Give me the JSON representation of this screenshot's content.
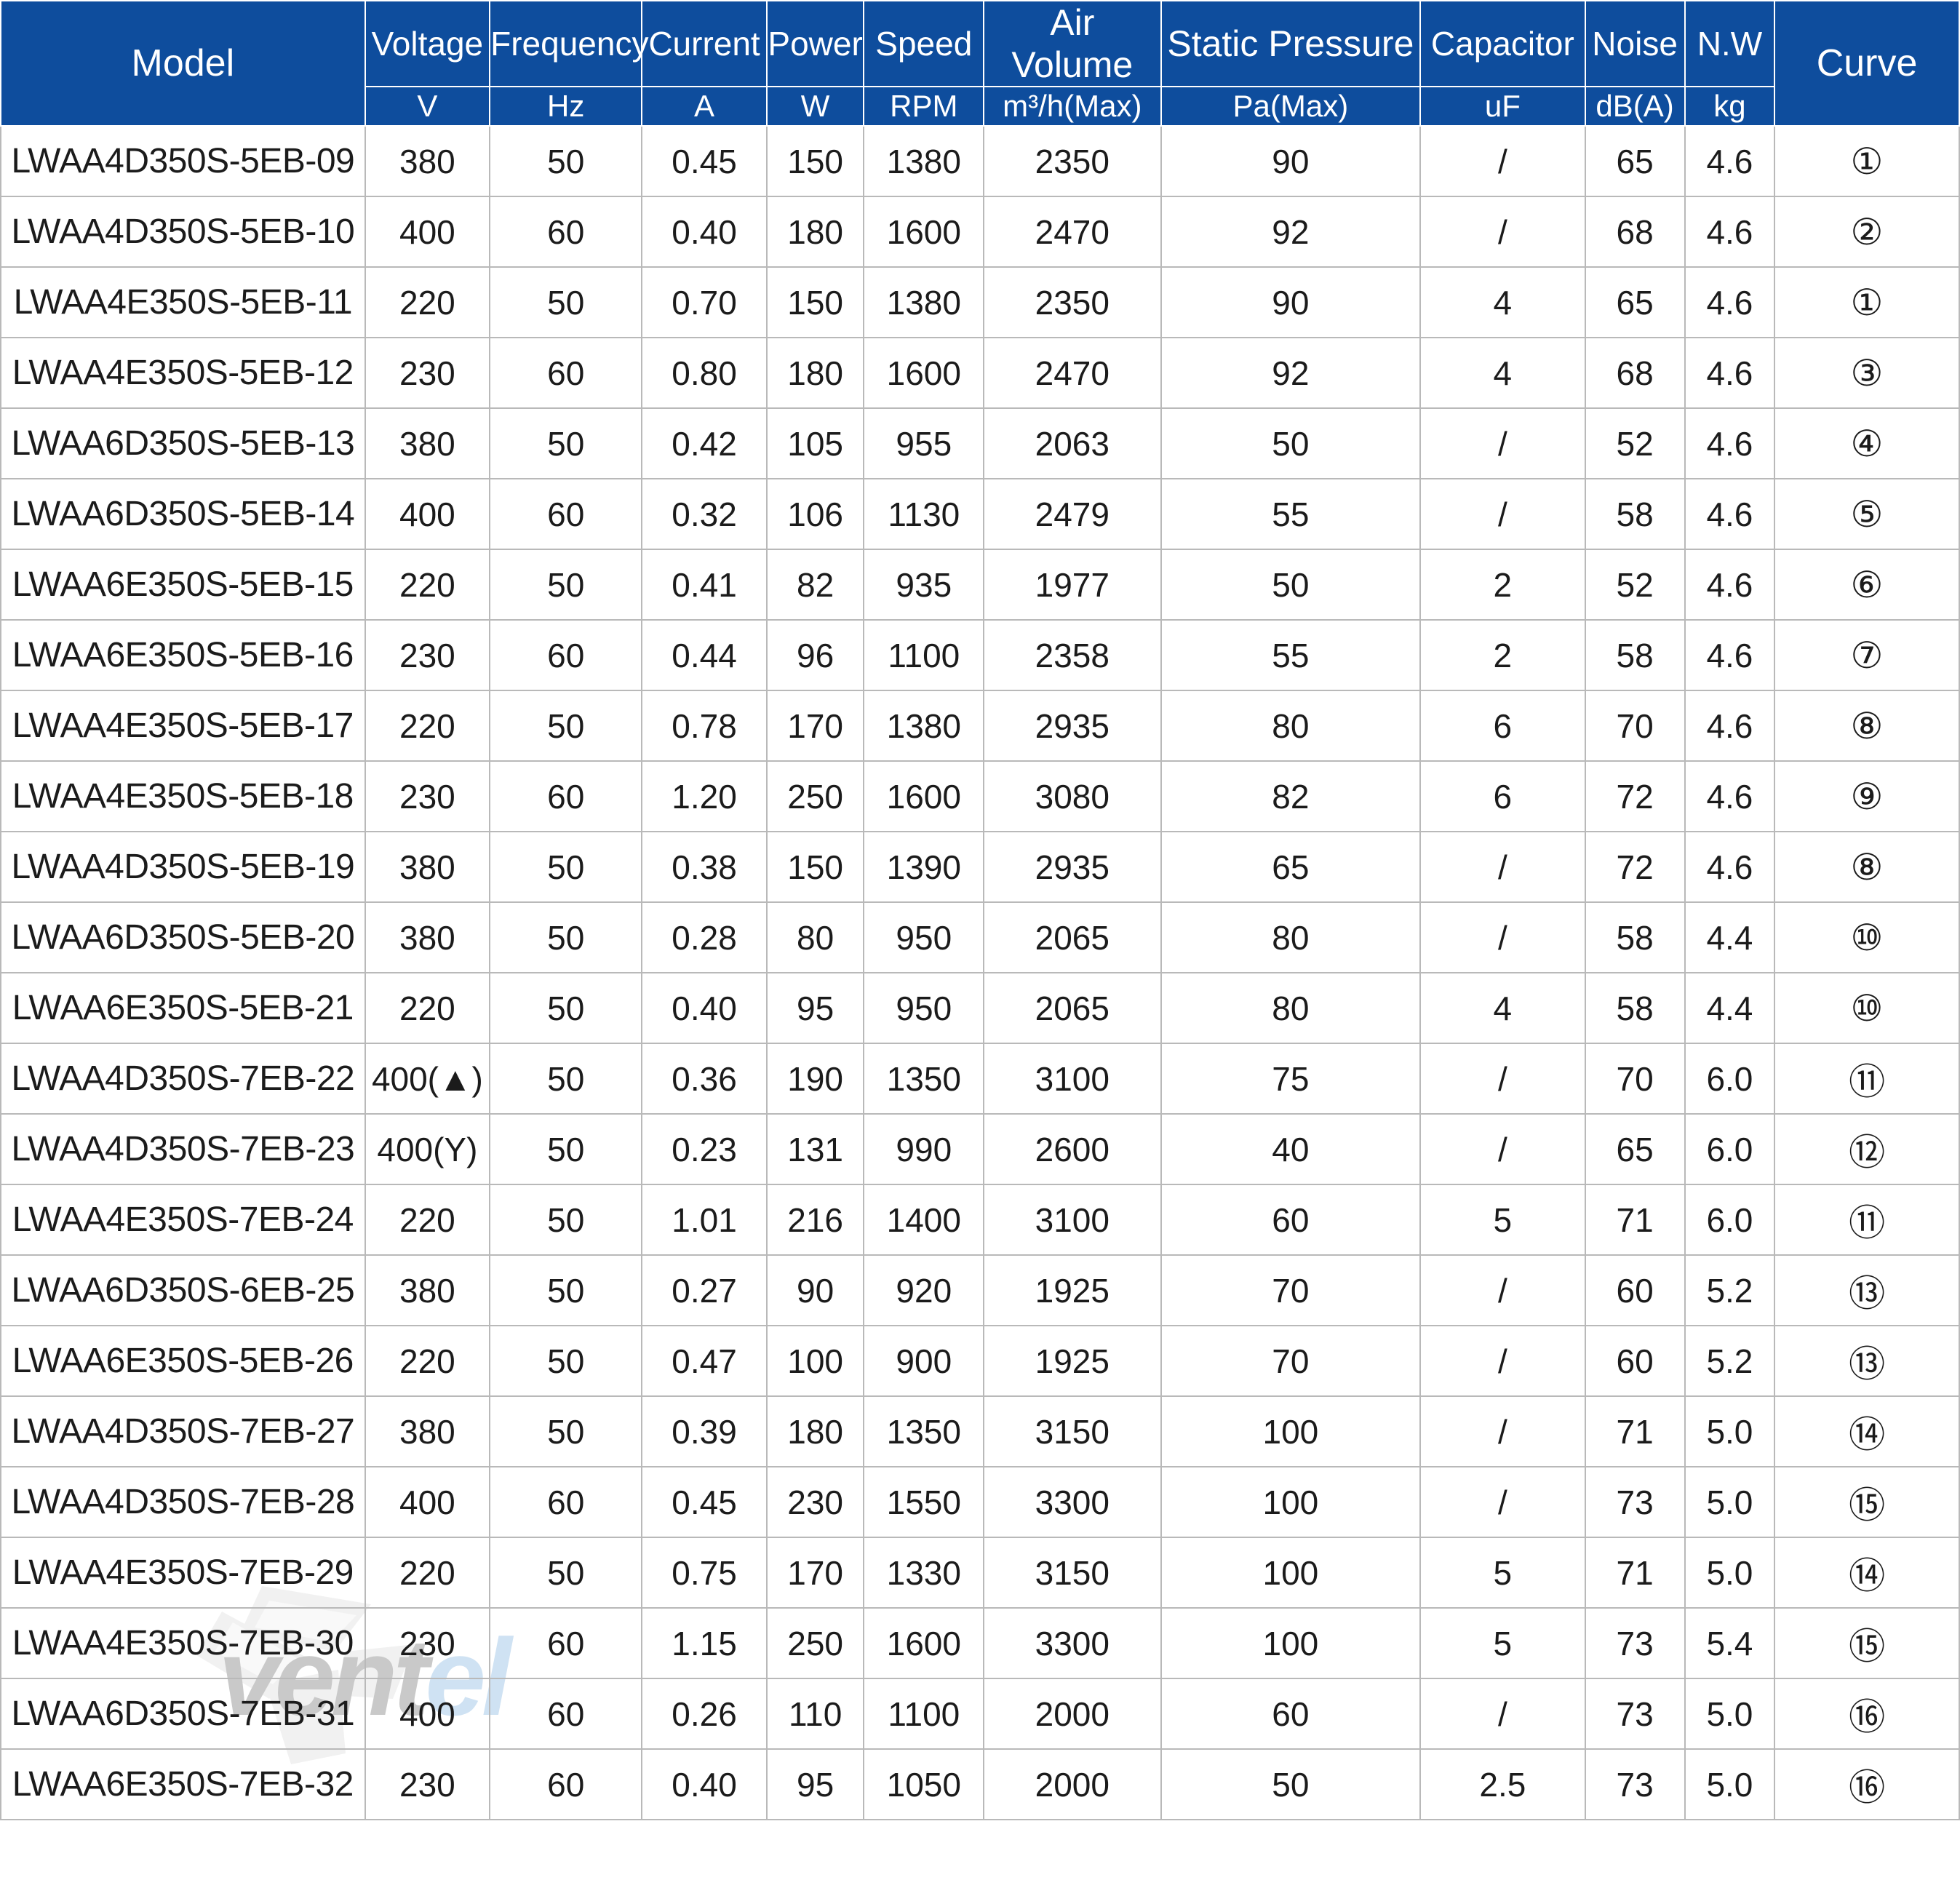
{
  "table": {
    "headers": {
      "model": "Model",
      "columns": [
        {
          "name": "Voltage",
          "unit": "V"
        },
        {
          "name": "Frequency",
          "unit": "Hz"
        },
        {
          "name": "Current",
          "unit": "A"
        },
        {
          "name": "Power",
          "unit": "W"
        },
        {
          "name": "Speed",
          "unit": "RPM"
        },
        {
          "name": "Air Volume",
          "unit": "m³/h(Max)"
        },
        {
          "name": "Static Pressure",
          "unit": "Pa(Max)"
        },
        {
          "name": "Capacitor",
          "unit": "uF"
        },
        {
          "name": "Noise",
          "unit": "dB(A)"
        },
        {
          "name": "N.W",
          "unit": "kg"
        }
      ],
      "curve": "Curve"
    },
    "rows": [
      {
        "model": "LWAA4D350S-5EB-09",
        "voltage": "380",
        "frequency": "50",
        "current": "0.45",
        "power": "150",
        "speed": "1380",
        "air_volume": "2350",
        "static_pressure": "90",
        "capacitor": "/",
        "noise": "65",
        "nw": "4.6",
        "curve": "①"
      },
      {
        "model": "LWAA4D350S-5EB-10",
        "voltage": "400",
        "frequency": "60",
        "current": "0.40",
        "power": "180",
        "speed": "1600",
        "air_volume": "2470",
        "static_pressure": "92",
        "capacitor": "/",
        "noise": "68",
        "nw": "4.6",
        "curve": "②"
      },
      {
        "model": "LWAA4E350S-5EB-11",
        "voltage": "220",
        "frequency": "50",
        "current": "0.70",
        "power": "150",
        "speed": "1380",
        "air_volume": "2350",
        "static_pressure": "90",
        "capacitor": "4",
        "noise": "65",
        "nw": "4.6",
        "curve": "①"
      },
      {
        "model": "LWAA4E350S-5EB-12",
        "voltage": "230",
        "frequency": "60",
        "current": "0.80",
        "power": "180",
        "speed": "1600",
        "air_volume": "2470",
        "static_pressure": "92",
        "capacitor": "4",
        "noise": "68",
        "nw": "4.6",
        "curve": "③"
      },
      {
        "model": "LWAA6D350S-5EB-13",
        "voltage": "380",
        "frequency": "50",
        "current": "0.42",
        "power": "105",
        "speed": "955",
        "air_volume": "2063",
        "static_pressure": "50",
        "capacitor": "/",
        "noise": "52",
        "nw": "4.6",
        "curve": "④"
      },
      {
        "model": "LWAA6D350S-5EB-14",
        "voltage": "400",
        "frequency": "60",
        "current": "0.32",
        "power": "106",
        "speed": "1130",
        "air_volume": "2479",
        "static_pressure": "55",
        "capacitor": "/",
        "noise": "58",
        "nw": "4.6",
        "curve": "⑤"
      },
      {
        "model": "LWAA6E350S-5EB-15",
        "voltage": "220",
        "frequency": "50",
        "current": "0.41",
        "power": "82",
        "speed": "935",
        "air_volume": "1977",
        "static_pressure": "50",
        "capacitor": "2",
        "noise": "52",
        "nw": "4.6",
        "curve": "⑥"
      },
      {
        "model": "LWAA6E350S-5EB-16",
        "voltage": "230",
        "frequency": "60",
        "current": "0.44",
        "power": "96",
        "speed": "1100",
        "air_volume": "2358",
        "static_pressure": "55",
        "capacitor": "2",
        "noise": "58",
        "nw": "4.6",
        "curve": "⑦"
      },
      {
        "model": "LWAA4E350S-5EB-17",
        "voltage": "220",
        "frequency": "50",
        "current": "0.78",
        "power": "170",
        "speed": "1380",
        "air_volume": "2935",
        "static_pressure": "80",
        "capacitor": "6",
        "noise": "70",
        "nw": "4.6",
        "curve": "⑧"
      },
      {
        "model": "LWAA4E350S-5EB-18",
        "voltage": "230",
        "frequency": "60",
        "current": "1.20",
        "power": "250",
        "speed": "1600",
        "air_volume": "3080",
        "static_pressure": "82",
        "capacitor": "6",
        "noise": "72",
        "nw": "4.6",
        "curve": "⑨"
      },
      {
        "model": "LWAA4D350S-5EB-19",
        "voltage": "380",
        "frequency": "50",
        "current": "0.38",
        "power": "150",
        "speed": "1390",
        "air_volume": "2935",
        "static_pressure": "65",
        "capacitor": "/",
        "noise": "72",
        "nw": "4.6",
        "curve": "⑧"
      },
      {
        "model": "LWAA6D350S-5EB-20",
        "voltage": "380",
        "frequency": "50",
        "current": "0.28",
        "power": "80",
        "speed": "950",
        "air_volume": "2065",
        "static_pressure": "80",
        "capacitor": "/",
        "noise": "58",
        "nw": "4.4",
        "curve": "⑩"
      },
      {
        "model": "LWAA6E350S-5EB-21",
        "voltage": "220",
        "frequency": "50",
        "current": "0.40",
        "power": "95",
        "speed": "950",
        "air_volume": "2065",
        "static_pressure": "80",
        "capacitor": "4",
        "noise": "58",
        "nw": "4.4",
        "curve": "⑩"
      },
      {
        "model": "LWAA4D350S-7EB-22",
        "voltage": "400(▲)",
        "frequency": "50",
        "current": "0.36",
        "power": "190",
        "speed": "1350",
        "air_volume": "3100",
        "static_pressure": "75",
        "capacitor": "/",
        "noise": "70",
        "nw": "6.0",
        "curve": "⑪"
      },
      {
        "model": "LWAA4D350S-7EB-23",
        "voltage": "400(Y)",
        "frequency": "50",
        "current": "0.23",
        "power": "131",
        "speed": "990",
        "air_volume": "2600",
        "static_pressure": "40",
        "capacitor": "/",
        "noise": "65",
        "nw": "6.0",
        "curve": "⑫"
      },
      {
        "model": "LWAA4E350S-7EB-24",
        "voltage": "220",
        "frequency": "50",
        "current": "1.01",
        "power": "216",
        "speed": "1400",
        "air_volume": "3100",
        "static_pressure": "60",
        "capacitor": "5",
        "noise": "71",
        "nw": "6.0",
        "curve": "⑪"
      },
      {
        "model": "LWAA6D350S-6EB-25",
        "voltage": "380",
        "frequency": "50",
        "current": "0.27",
        "power": "90",
        "speed": "920",
        "air_volume": "1925",
        "static_pressure": "70",
        "capacitor": "/",
        "noise": "60",
        "nw": "5.2",
        "curve": "⑬"
      },
      {
        "model": "LWAA6E350S-5EB-26",
        "voltage": "220",
        "frequency": "50",
        "current": "0.47",
        "power": "100",
        "speed": "900",
        "air_volume": "1925",
        "static_pressure": "70",
        "capacitor": "/",
        "noise": "60",
        "nw": "5.2",
        "curve": "⑬"
      },
      {
        "model": "LWAA4D350S-7EB-27",
        "voltage": "380",
        "frequency": "50",
        "current": "0.39",
        "power": "180",
        "speed": "1350",
        "air_volume": "3150",
        "static_pressure": "100",
        "capacitor": "/",
        "noise": "71",
        "nw": "5.0",
        "curve": "⑭"
      },
      {
        "model": "LWAA4D350S-7EB-28",
        "voltage": "400",
        "frequency": "60",
        "current": "0.45",
        "power": "230",
        "speed": "1550",
        "air_volume": "3300",
        "static_pressure": "100",
        "capacitor": "/",
        "noise": "73",
        "nw": "5.0",
        "curve": "⑮"
      },
      {
        "model": "LWAA4E350S-7EB-29",
        "voltage": "220",
        "frequency": "50",
        "current": "0.75",
        "power": "170",
        "speed": "1330",
        "air_volume": "3150",
        "static_pressure": "100",
        "capacitor": "5",
        "noise": "71",
        "nw": "5.0",
        "curve": "⑭"
      },
      {
        "model": "LWAA4E350S-7EB-30",
        "voltage": "230",
        "frequency": "60",
        "current": "1.15",
        "power": "250",
        "speed": "1600",
        "air_volume": "3300",
        "static_pressure": "100",
        "capacitor": "5",
        "noise": "73",
        "nw": "5.4",
        "curve": "⑮"
      },
      {
        "model": "LWAA6D350S-7EB-31",
        "voltage": "400",
        "frequency": "60",
        "current": "0.26",
        "power": "110",
        "speed": "1100",
        "air_volume": "2000",
        "static_pressure": "60",
        "capacitor": "/",
        "noise": "73",
        "nw": "5.0",
        "curve": "⑯"
      },
      {
        "model": "LWAA6E350S-7EB-32",
        "voltage": "230",
        "frequency": "60",
        "current": "0.40",
        "power": "95",
        "speed": "1050",
        "air_volume": "2000",
        "static_pressure": "50",
        "capacitor": "2.5",
        "noise": "73",
        "nw": "5.0",
        "curve": "⑯"
      }
    ]
  },
  "watermark": {
    "text_primary": "vent",
    "text_secondary": "el"
  },
  "colors": {
    "header_blue": "#0E4D9D",
    "grid_line": "#b9b9b9",
    "text": "#1b1b1b",
    "watermark_gray": "#c9c9c9",
    "watermark_blue": "#cfe2f3"
  }
}
